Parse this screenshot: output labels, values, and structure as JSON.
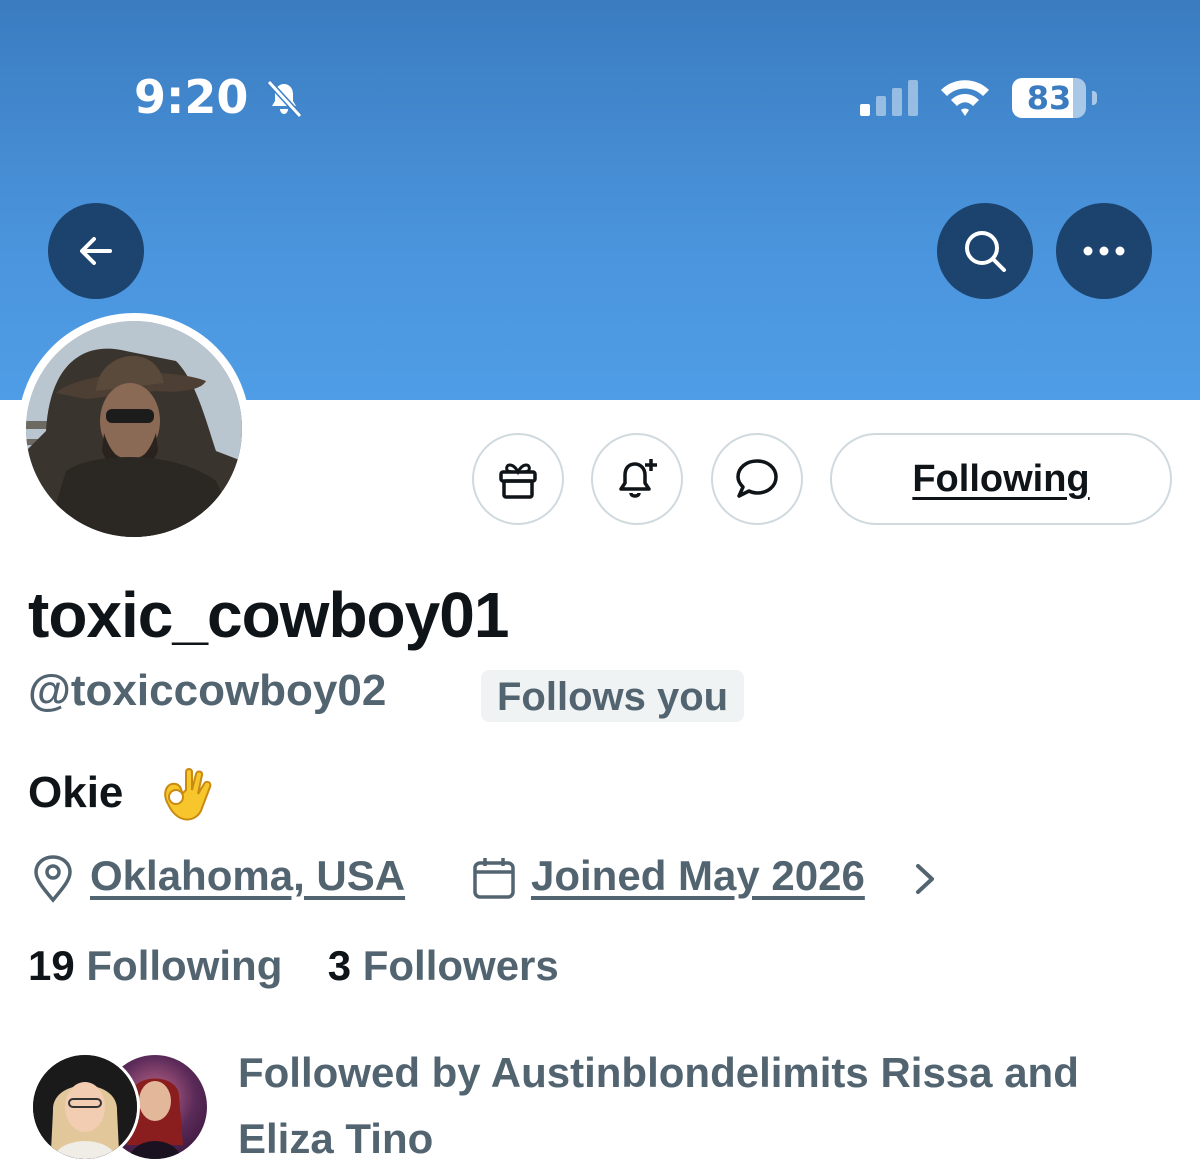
{
  "status_bar": {
    "time": "9:20",
    "battery": "83",
    "battery_level": 0.83
  },
  "nav": {
    "back_icon": "arrow-left-icon",
    "search_icon": "search-icon",
    "more_icon": "more-dots-icon"
  },
  "actions": {
    "gift_icon": "gift-icon",
    "notify_icon": "bell-plus-icon",
    "message_icon": "message-bubble-icon",
    "following_label": "Following"
  },
  "profile": {
    "display_name": "toxic_cowboy01",
    "handle": "@toxiccowboy02",
    "follows_you": "Follows you",
    "bio": "Okie",
    "bio_emoji": "ok-hand-emoji",
    "location": "Oklahoma, USA",
    "joined": "Joined May 2026",
    "following_count": "19",
    "following_label": "Following",
    "followers_count": "3",
    "followers_label": "Followers",
    "followed_by": "Followed by Austinblondelimits Rissa and Eliza Tino"
  },
  "colors": {
    "banner": "#4a94dc",
    "secondary_text": "#536471",
    "primary_text": "#0f1419"
  }
}
